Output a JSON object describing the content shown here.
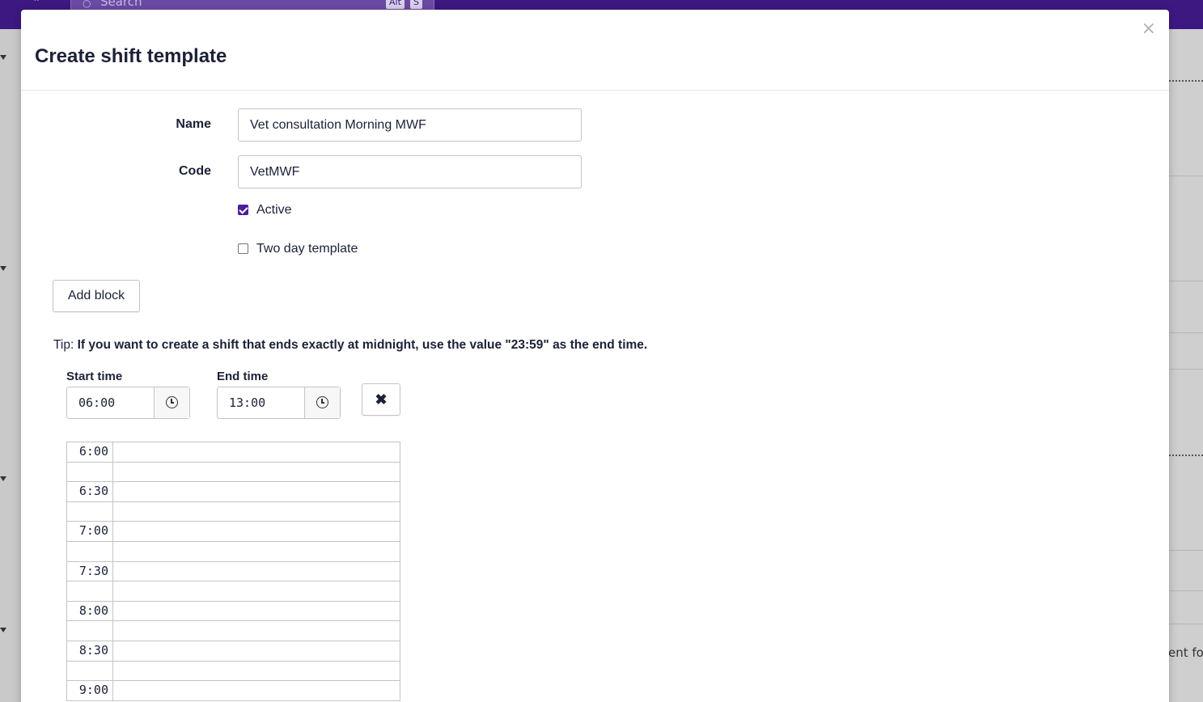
{
  "background": {
    "search_placeholder": "Search",
    "shortcut_keys": [
      "Alt",
      "S"
    ],
    "partial_text": "ent for"
  },
  "modal": {
    "title": "Create shift template",
    "close_label": "×"
  },
  "form": {
    "name_label": "Name",
    "name_value": "Vet consultation Morning MWF",
    "code_label": "Code",
    "code_value": "VetMWF",
    "active_label": "Active",
    "active_checked": true,
    "two_day_label": "Two day template",
    "two_day_checked": false,
    "add_block_label": "Add block"
  },
  "tip": {
    "prefix": "Tip:",
    "text": "If you want to create a shift that ends exactly at midnight, use the value \"23:59\" as the end time."
  },
  "block": {
    "start_label": "Start time",
    "start_value": "06:00",
    "end_label": "End time",
    "end_value": "13:00",
    "remove_label": "✖"
  },
  "timeline": {
    "rows": [
      "6:00",
      "",
      "6:30",
      "",
      "7:00",
      "",
      "7:30",
      "",
      "8:00",
      "",
      "8:30",
      "",
      "9:00"
    ]
  },
  "colors": {
    "topbar": "#3d1880",
    "checkbox_accent": "#4b1e9c",
    "text": "#1c2138"
  }
}
